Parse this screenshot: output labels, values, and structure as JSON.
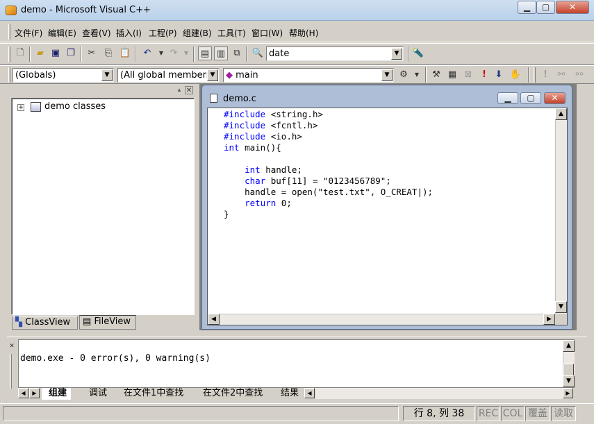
{
  "window": {
    "title": "demo - Microsoft Visual C++",
    "controls": {
      "minimize": "▁",
      "maximize": "▢",
      "close": "✕"
    }
  },
  "menu": [
    "文件(F)",
    "编辑(E)",
    "查看(V)",
    "插入(I)",
    "工程(P)",
    "组建(B)",
    "工具(T)",
    "窗口(W)",
    "帮助(H)"
  ],
  "toolbar": {
    "find_combo": "date",
    "scope_combo": "(Globals)",
    "members_combo": "(All global members",
    "function_combo": "main"
  },
  "workspace": {
    "tree_root": "demo classes",
    "tabs": [
      "ClassView",
      "FileView"
    ]
  },
  "editor": {
    "title": "demo.c",
    "code_lines": [
      [
        [
          "kw",
          "#include"
        ],
        [
          "",
          " <string.h>"
        ]
      ],
      [
        [
          "kw",
          "#include"
        ],
        [
          "",
          " <fcntl.h>"
        ]
      ],
      [
        [
          "kw",
          "#include"
        ],
        [
          "",
          " <io.h>"
        ]
      ],
      [
        [
          "kw",
          "int"
        ],
        [
          "",
          " main(){"
        ]
      ],
      [
        [
          "",
          ""
        ]
      ],
      [
        [
          "",
          "    "
        ],
        [
          "kw",
          "int"
        ],
        [
          "",
          " handle;"
        ]
      ],
      [
        [
          "",
          "    "
        ],
        [
          "kw",
          "char"
        ],
        [
          "",
          " buf[11] = \"0123456789\";"
        ]
      ],
      [
        [
          "",
          "    handle = open(\"test.txt\", O_CREAT|);"
        ]
      ],
      [
        [
          "",
          "    "
        ],
        [
          "kw",
          "return"
        ],
        [
          "",
          " 0;"
        ]
      ],
      [
        [
          "",
          "}"
        ]
      ]
    ]
  },
  "output": {
    "line": "demo.exe - 0 error(s), 0 warning(s)",
    "tabs": [
      "组建",
      "调试",
      "在文件1中查找",
      "在文件2中查找",
      "结果"
    ]
  },
  "status": {
    "position": "行 8, 列 38",
    "rec": "REC",
    "col": "COL",
    "ovr": "覆盖",
    "read": "读取"
  },
  "colors": {
    "keyword": "#0000ff",
    "face": "#d4d0c8",
    "mdi_frame": "#aebed6"
  }
}
